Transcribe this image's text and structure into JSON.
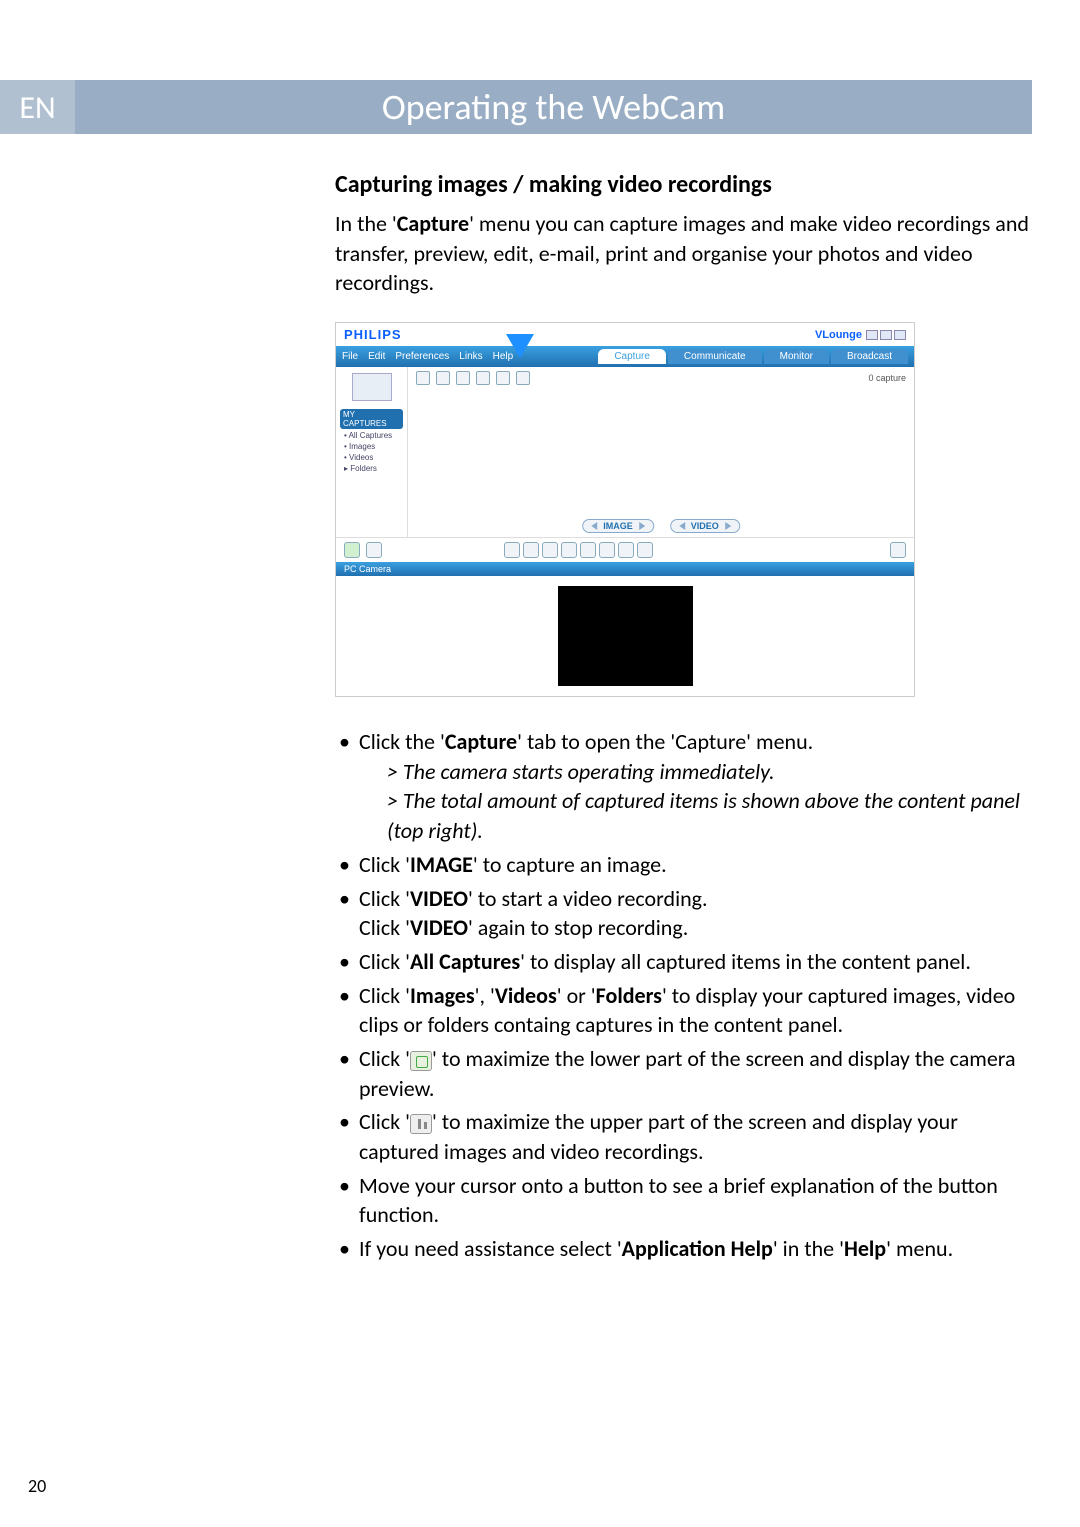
{
  "lang": "EN",
  "title": "Operating the WebCam",
  "subhead": "Capturing images / making video recordings",
  "introA": "In the '",
  "introBold": "Capture",
  "introB": "' menu you can capture images and make video recordings and transfer, preview, edit, e-mail, print and organise your photos and video recordings.",
  "app": {
    "logo": "PHILIPS",
    "vlounge": "VLounge",
    "menu": [
      "File",
      "Edit",
      "Preferences",
      "Links",
      "Help"
    ],
    "tabs": {
      "capture": "Capture",
      "communicate": "Communicate",
      "monitor": "Monitor",
      "broadcast": "Broadcast"
    },
    "sidebar": {
      "header": "MY CAPTURES",
      "items": [
        "All Captures",
        "Images",
        "Videos",
        "Folders"
      ]
    },
    "count": "0 capture",
    "imageBtn": "IMAGE",
    "videoBtn": "VIDEO",
    "lowbar": "PC Camera"
  },
  "b1a": "Click the '",
  "b1bold": "Capture",
  "b1b": "' tab to open the 'Capture' menu.",
  "b1note1": "> The camera starts operating immediately.",
  "b1note2": "> The total amount of captured items is shown above the content panel (top right).",
  "b2a": "Click '",
  "b2bold": "IMAGE",
  "b2b": "' to capture an image.",
  "b3a": "Click '",
  "b3bold": "VIDEO",
  "b3b": "' to start a video recording.",
  "b3c": "Click '",
  "b3bold2": "VIDEO",
  "b3d": "' again to stop recording.",
  "b4a": "Click '",
  "b4bold": "All Captures",
  "b4b": "' to display all captured items in the content panel.",
  "b5a": "Click '",
  "b5b1": "Images",
  "b5m1": "', '",
  "b5b2": "Videos",
  "b5m2": "' or '",
  "b5b3": "Folders",
  "b5c": "' to display your captured images, video clips or folders containg captures in the content panel.",
  "b6a": "Click '",
  "b6b": "' to maximize the lower part of the screen and display the camera preview.",
  "b7a": "Click '",
  "b7b": "' to maximize the upper part of the screen and display your captured images and video recordings.",
  "b8": "Move your cursor onto a button to see a brief explanation of the button function.",
  "b9a": "If you need assistance select '",
  "b9bold": "Application Help",
  "b9b": "' in the '",
  "b9bold2": "Help",
  "b9c": "' menu.",
  "pagenum": "20"
}
